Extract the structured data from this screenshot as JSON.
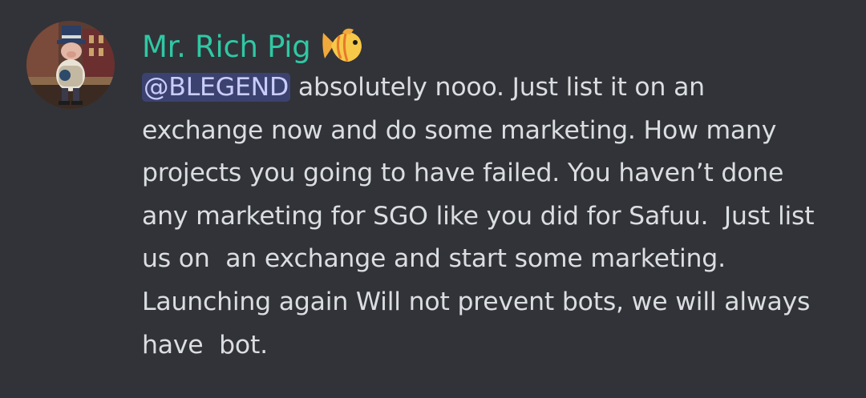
{
  "message": {
    "author": "Mr. Rich Pig",
    "author_color": "#2fc8a4",
    "author_emoji": "tropical-fish-icon",
    "avatar_description_icon": "rich-pig-avatar-icon",
    "mention": "@BLEGEND",
    "mention_bg": "#3c4270",
    "lines": [
      " absolutely nooo. Just list it on an",
      "exchange now and do some marketing. How many",
      "projects you going to have failed. You haven’t done",
      "any marketing for SGO like you did for Safuu.  Just list",
      "us on  an exchange and start some marketing.",
      "Launching again Will not prevent bots, we will always",
      "have  bot."
    ]
  },
  "colors": {
    "background": "#313338",
    "text": "#dbdee1"
  }
}
